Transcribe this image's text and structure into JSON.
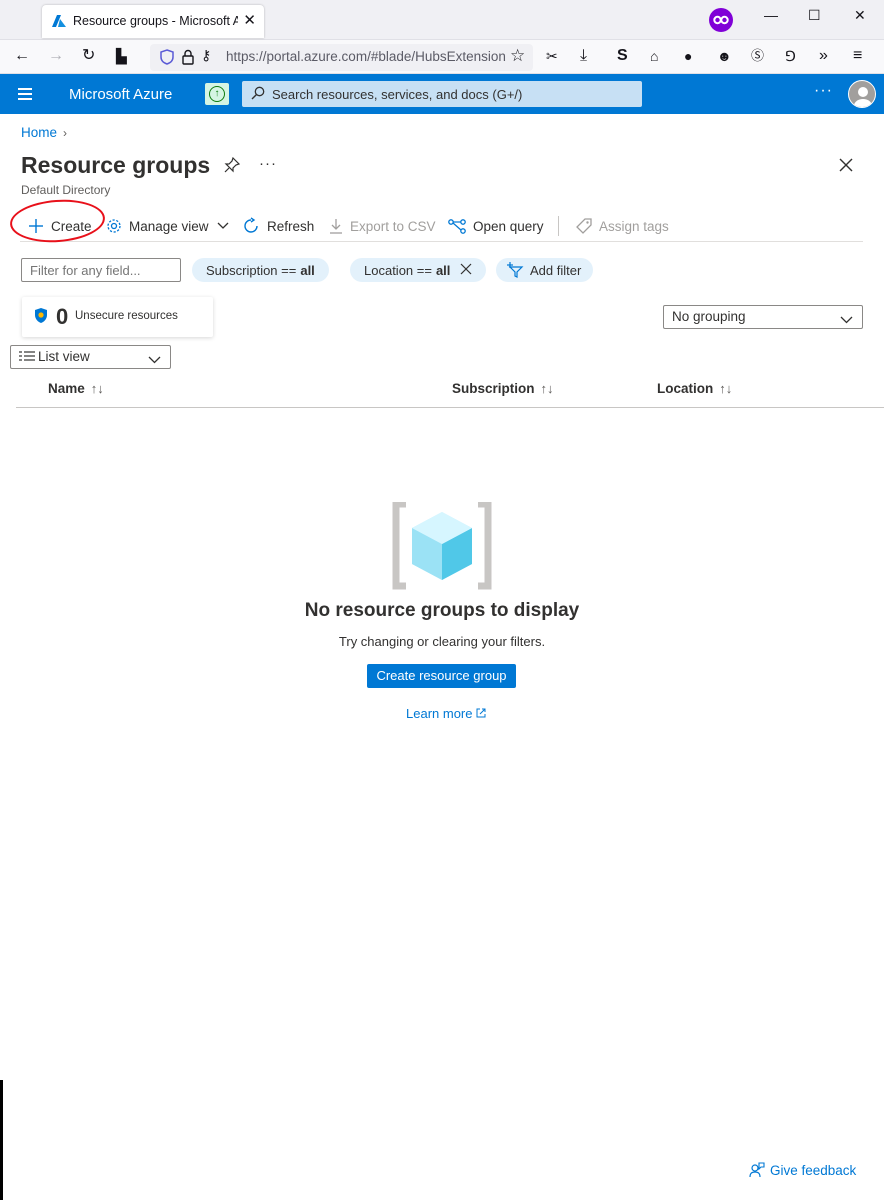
{
  "browser": {
    "tab_title": "Resource groups - Microsoft Azure",
    "url": "https://portal.azure.com/#blade/HubsExtension/BrowseResourceGroups"
  },
  "topbar": {
    "brand": "Microsoft Azure",
    "search_placeholder": "Search resources, services, and docs (G+/)",
    "more": "···"
  },
  "breadcrumb": {
    "home": "Home"
  },
  "blade": {
    "title": "Resource groups",
    "subtitle": "Default Directory",
    "more": "···"
  },
  "toolbar": {
    "create": "Create",
    "manage_view": "Manage view",
    "refresh": "Refresh",
    "export_csv": "Export to CSV",
    "open_query": "Open query",
    "assign_tags": "Assign tags"
  },
  "filters": {
    "field_placeholder": "Filter for any field...",
    "subscription_label": "Subscription ==",
    "subscription_value": "all",
    "location_label": "Location ==",
    "location_value": "all",
    "add_filter": "Add filter"
  },
  "security": {
    "count": "0",
    "label": "Unsecure resources"
  },
  "grouping": {
    "selected": "No grouping"
  },
  "view_mode": {
    "selected": "List view"
  },
  "columns": [
    {
      "label": "Name"
    },
    {
      "label": "Subscription"
    },
    {
      "label": "Location"
    }
  ],
  "empty_state": {
    "title": "No resource groups to display",
    "subtitle": "Try changing or clearing your filters.",
    "button": "Create resource group",
    "learn_more": "Learn more"
  },
  "feedback": "Give feedback",
  "colors": {
    "azure_blue": "#0078d4",
    "annotation_red": "#e8101a"
  }
}
